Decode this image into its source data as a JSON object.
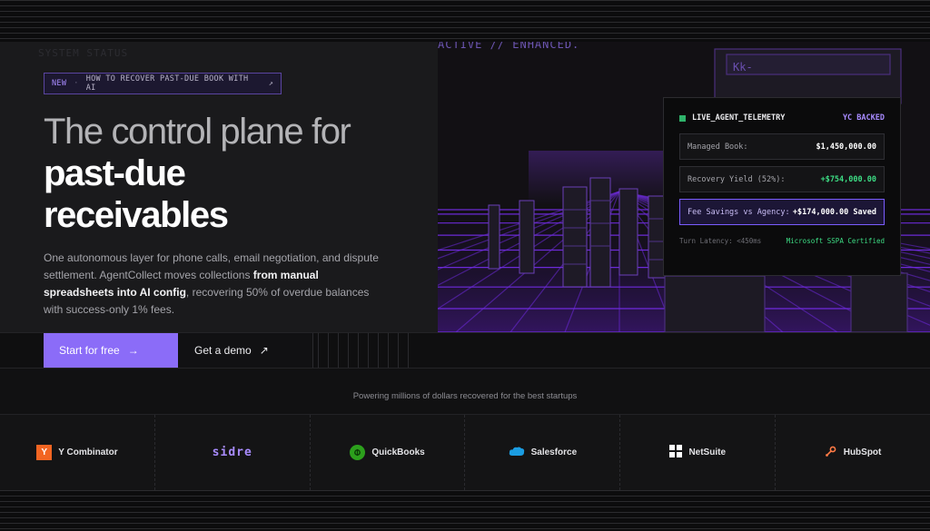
{
  "announcement": {
    "tag": "NEW",
    "separator": "·",
    "text": "HOW TO RECOVER PAST-DUE BOOK WITH AI",
    "arrow": "↗"
  },
  "background": {
    "system_label": "SYSTEM STATUS",
    "active_label": "ACTIVE // ENHANCED."
  },
  "hero": {
    "line1": "The control plane for",
    "line2": "past-due",
    "line3": "receivables",
    "desc_a": "One autonomous layer for phone calls, email negotiation, and dispute settlement. AgentCollect moves collections ",
    "desc_b": "from manual spreadsheets into AI config",
    "desc_c": ", recovering 50% of overdue balances with success-only 1% fees."
  },
  "telemetry": {
    "title": "LIVE_AGENT_TELEMETRY",
    "badge": "YC BACKED",
    "rows": [
      {
        "label": "Managed Book:",
        "value": "$1,450,000.00"
      },
      {
        "label": "Recovery Yield (52%):",
        "value": "+$754,000.00"
      },
      {
        "label": "Fee Savings vs Agency:",
        "value": "+$174,000.00 Saved"
      }
    ],
    "latency": "Turn Latency: <450ms",
    "certification": "Microsoft SSPA Certified"
  },
  "cta": {
    "primary": "Start for free",
    "primary_icon": "→",
    "secondary": "Get a demo",
    "secondary_icon": "↗"
  },
  "powering": "Powering millions of dollars recovered for the best startups",
  "logos": [
    {
      "name": "Y Combinator",
      "icon": "Y"
    },
    {
      "name": "Sidre"
    },
    {
      "name": "QuickBooks"
    },
    {
      "name": "Salesforce"
    },
    {
      "name": "NetSuite"
    },
    {
      "name": "HubSpot"
    }
  ],
  "colors": {
    "accent": "#8b6cf8",
    "green": "#3ddc84",
    "grid": "#7b2ff7"
  }
}
